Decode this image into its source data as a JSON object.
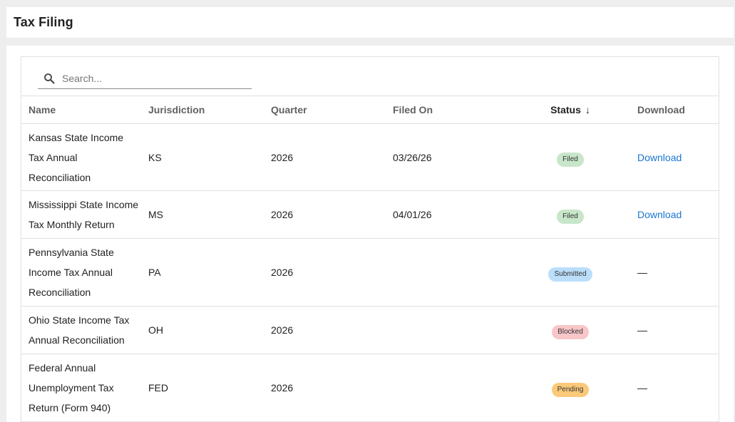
{
  "header": {
    "title": "Tax Filing"
  },
  "search": {
    "placeholder": "Search..."
  },
  "table": {
    "columns": {
      "name": "Name",
      "jurisdiction": "Jurisdiction",
      "quarter": "Quarter",
      "filed_on": "Filed On",
      "status": "Status",
      "status_sort_arrow": "↓",
      "download": "Download"
    },
    "rows": [
      {
        "name": "Kansas State Income Tax Annual Reconciliation",
        "jurisdiction": "KS",
        "quarter": "2026",
        "filed_on": "03/26/26",
        "status": "Filed",
        "status_color": "#c8e6c9",
        "download": "Download"
      },
      {
        "name": "Mississippi State Income Tax Monthly Return",
        "jurisdiction": "MS",
        "quarter": "2026",
        "filed_on": "04/01/26",
        "status": "Filed",
        "status_color": "#c8e6c9",
        "download": "Download"
      },
      {
        "name": "Pennsylvania State Income Tax Annual Reconciliation",
        "jurisdiction": "PA",
        "quarter": "2026",
        "filed_on": "",
        "status": "Submitted",
        "status_color": "#bbdefb",
        "download": "—"
      },
      {
        "name": "Ohio State Income Tax Annual Reconciliation",
        "jurisdiction": "OH",
        "quarter": "2026",
        "filed_on": "",
        "status": "Blocked",
        "status_color": "#f8c6c9",
        "download": "—"
      },
      {
        "name": "Federal Annual Unemployment Tax Return (Form 940)",
        "jurisdiction": "FED",
        "quarter": "2026",
        "filed_on": "",
        "status": "Pending",
        "status_color": "#fbc97a",
        "download": "—"
      }
    ]
  },
  "colors": {
    "link": "#1976d2"
  }
}
